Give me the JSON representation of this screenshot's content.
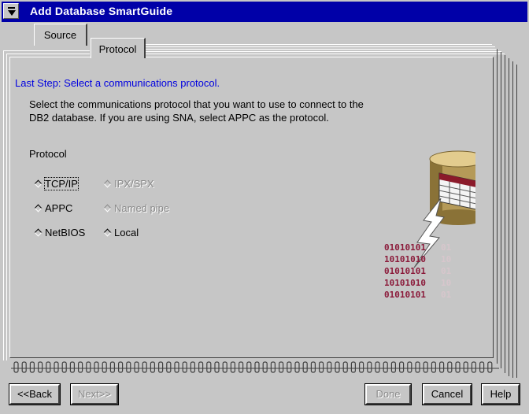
{
  "window": {
    "title": "Add Database SmartGuide"
  },
  "tabs": [
    {
      "label": "Source"
    },
    {
      "label": "Protocol"
    }
  ],
  "page": {
    "step_title": "Last Step: Select a communications protocol.",
    "description_line1": "Select the communications protocol that you want to use to connect to the",
    "description_line2": "DB2 database.  If you are using SNA, select APPC as the protocol.",
    "group_label": "Protocol"
  },
  "protocols": {
    "tcpip": {
      "label": "TCP/IP",
      "enabled": true,
      "focused": true
    },
    "ipxspx": {
      "label": "IPX/SPX",
      "enabled": false
    },
    "appc": {
      "label": "APPC",
      "enabled": true
    },
    "named_pipe": {
      "label": "Named pipe",
      "enabled": false
    },
    "netbios": {
      "label": "NetBIOS",
      "enabled": true
    },
    "local": {
      "label": "Local",
      "enabled": true
    }
  },
  "graphic": {
    "binary_rows": [
      "01010101",
      "10101010",
      "01010101",
      "10101010",
      "01010101"
    ],
    "binary_fade": [
      "01",
      "10",
      "01",
      "10",
      "01"
    ]
  },
  "buttons": {
    "back": "<<Back",
    "next": "Next>>",
    "done": "Done",
    "cancel": "Cancel",
    "help": "Help"
  },
  "colors": {
    "title_bar": "#0000a8",
    "accent_text": "#0000e0",
    "binary_digits": "#8b1a3a"
  }
}
